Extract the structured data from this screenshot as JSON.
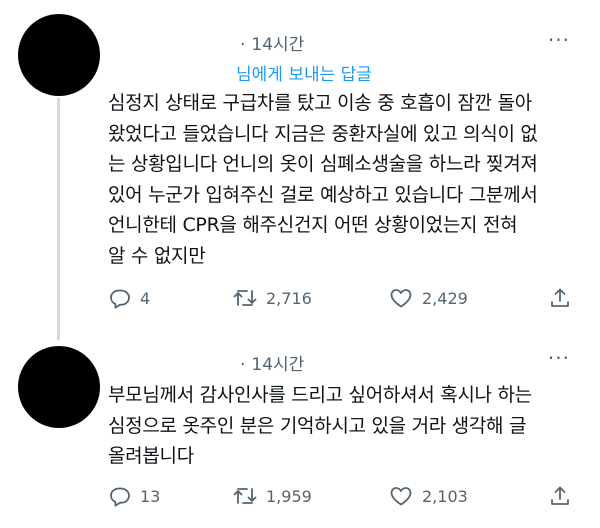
{
  "tweets": [
    {
      "time": "14시간",
      "more": "···",
      "reply_to": "님에게 보내는 답글",
      "text": "심정지 상태로 구급차를 탔고 이송 중 호흡이 잠깐 돌아\n왔었다고 들었습니다 지금은 중환자실에 있고 의식이 없\n는 상황입니다 언니의 옷이 심폐소생술을 하느라 찢겨져\n있어 누군가 입혀주신 걸로 예상하고 있습니다 그분께서\n언니한테 CPR을 해주신건지 어떤 상황이었는지 전혀\n알 수 없지만",
      "replies": "4",
      "retweets": "2,716",
      "likes": "2,429"
    },
    {
      "time": "14시간",
      "more": "···",
      "text": "부모님께서 감사인사를 드리고 싶어하셔서 혹시나 하는\n심정으로 옷주인 분은 기억하시고 있을 거라 생각해 글\n올려봅니다",
      "replies": "13",
      "retweets": "1,959",
      "likes": "2,103"
    }
  ],
  "icons": {
    "reply": "reply-icon",
    "retweet": "retweet-icon",
    "like": "heart-icon",
    "share": "share-icon"
  },
  "colors": {
    "text": "#0f1419",
    "secondary": "#536471",
    "link": "#1d9bf0",
    "thread_line": "#cfd9de"
  }
}
